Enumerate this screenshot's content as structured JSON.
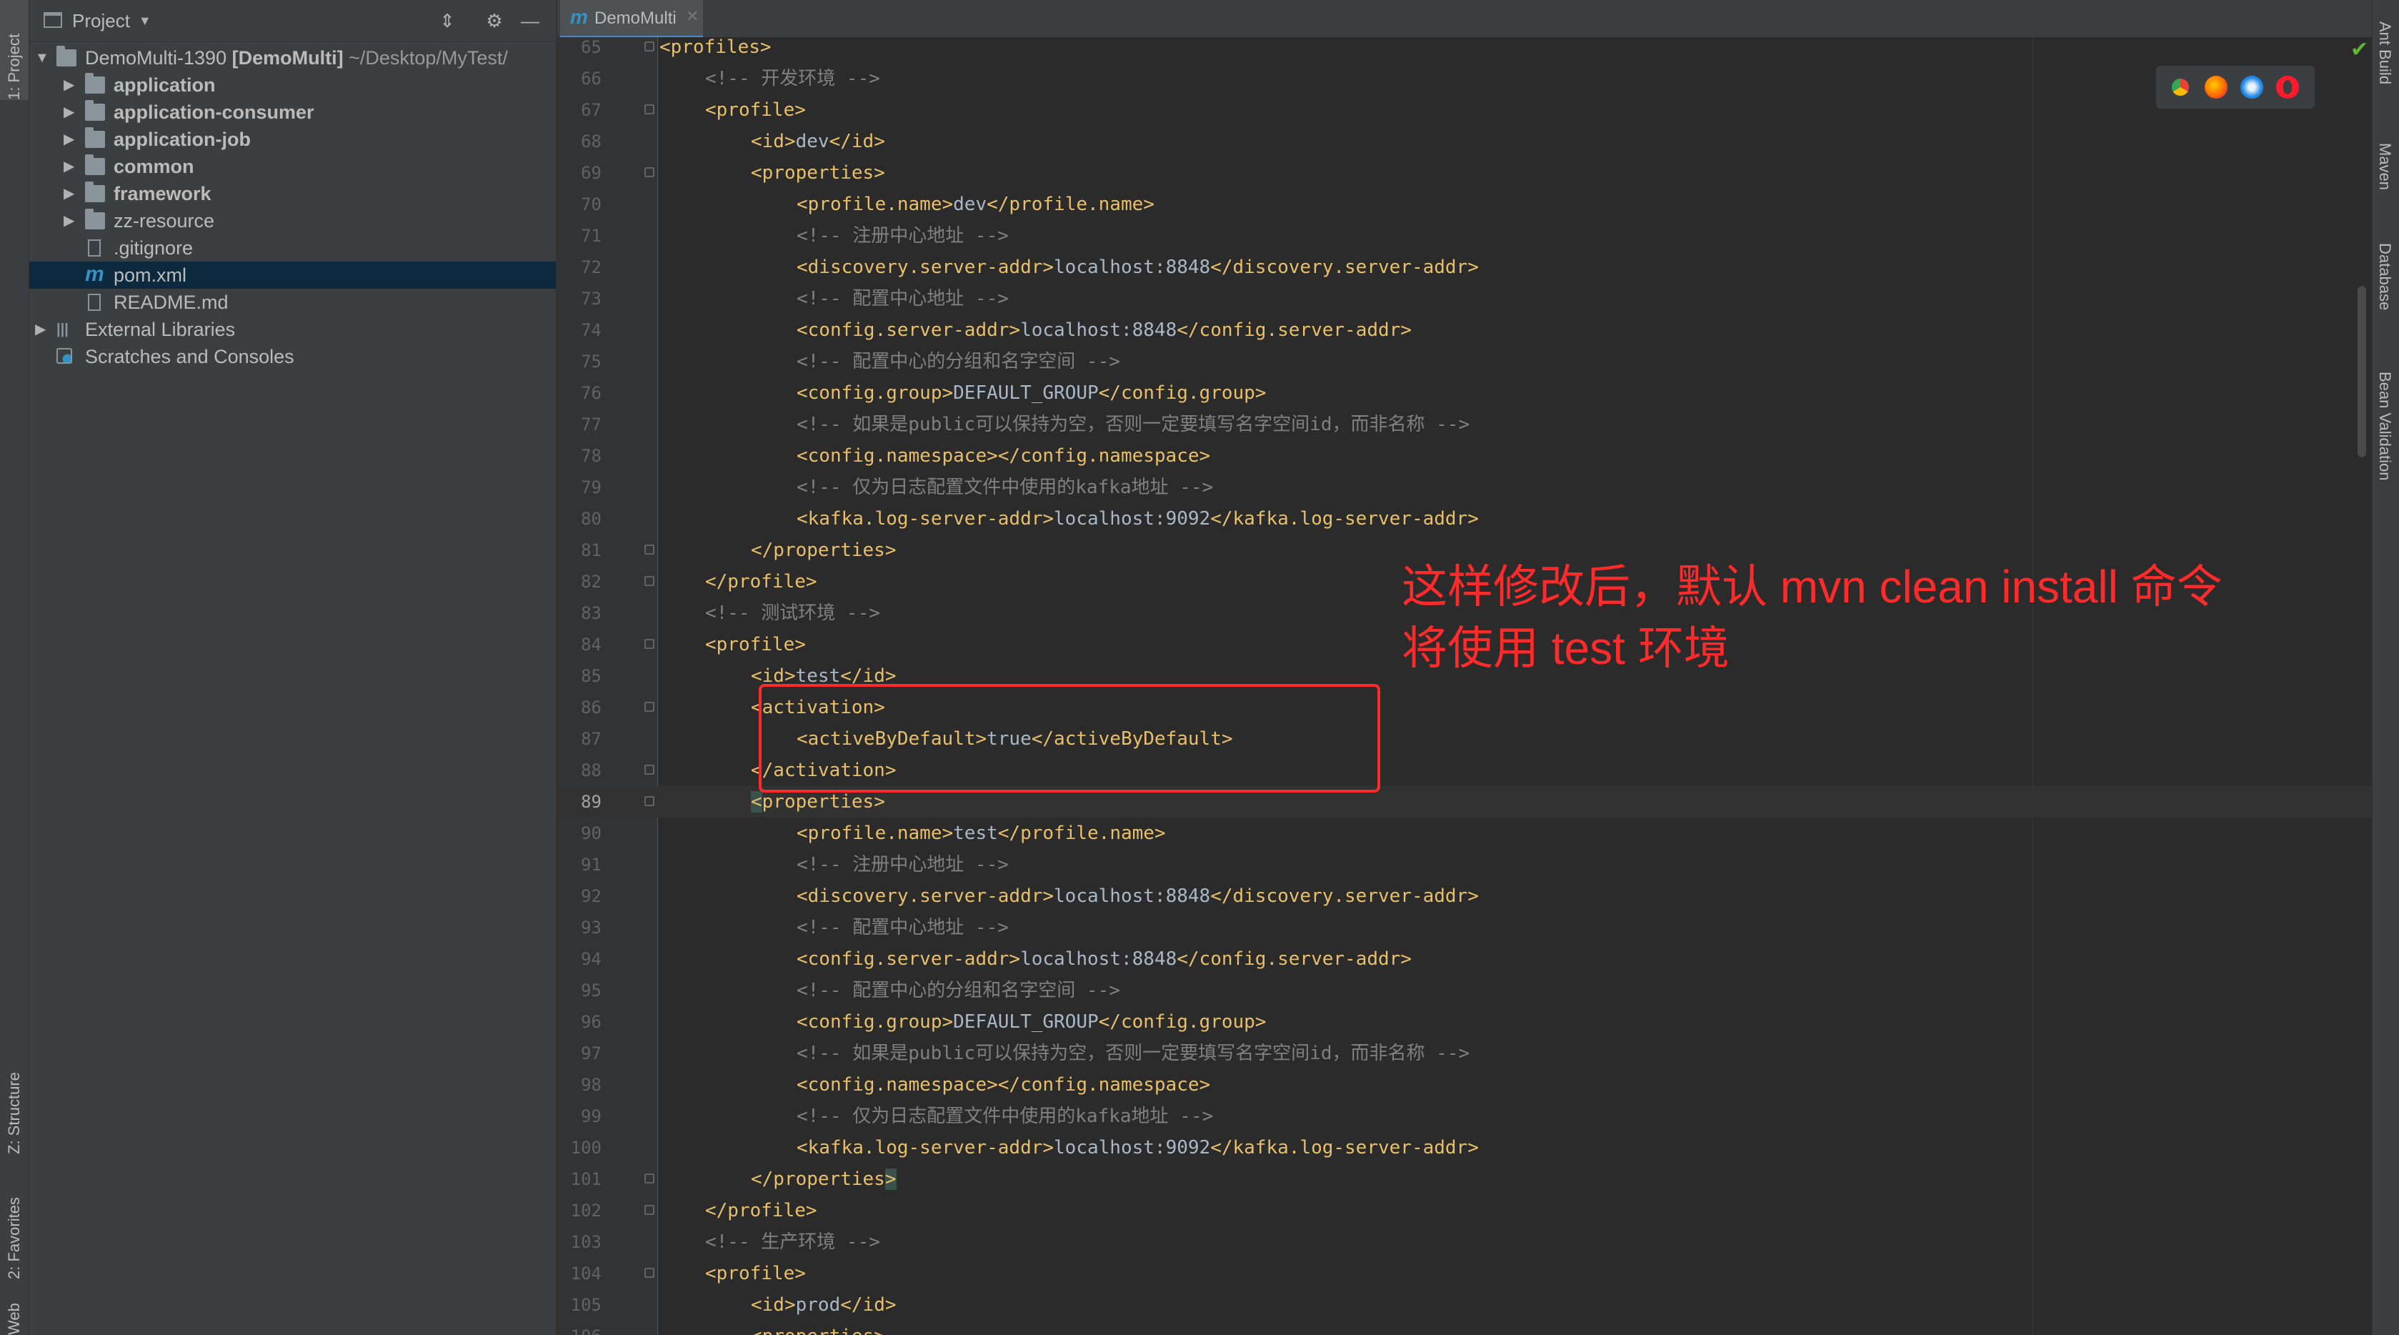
{
  "left_strip": {
    "project_tab": "1: Project",
    "structure_tab": "Z: Structure",
    "favorites_tab": "2: Favorites",
    "web_tab": "Web"
  },
  "project_panel": {
    "title": "Project",
    "tree": [
      {
        "label": "DemoMulti-1390",
        "extra": "[DemoMulti]",
        "path": "~/Desktop/MyTest/",
        "type": "module",
        "level": 0,
        "expanded": true
      },
      {
        "label": "application",
        "type": "folder",
        "level": 1,
        "bold": true
      },
      {
        "label": "application-consumer",
        "type": "folder",
        "level": 1,
        "bold": true
      },
      {
        "label": "application-job",
        "type": "folder",
        "level": 1,
        "bold": true
      },
      {
        "label": "common",
        "type": "folder",
        "level": 1,
        "bold": true
      },
      {
        "label": "framework",
        "type": "folder",
        "level": 1,
        "bold": true
      },
      {
        "label": "zz-resource",
        "type": "folder",
        "level": 1,
        "bold": false
      },
      {
        "label": ".gitignore",
        "type": "file",
        "level": 1
      },
      {
        "label": "pom.xml",
        "type": "maven",
        "level": 1,
        "selected": true
      },
      {
        "label": "README.md",
        "type": "md",
        "level": 1
      },
      {
        "label": "External Libraries",
        "type": "libs",
        "level": 0
      },
      {
        "label": "Scratches and Consoles",
        "type": "scratch",
        "level": 0
      }
    ]
  },
  "editor": {
    "tab_label": "DemoMulti",
    "current_line": 89,
    "lines": [
      {
        "n": "65",
        "i": 0,
        "p": [
          [
            "t",
            "<profiles>"
          ]
        ]
      },
      {
        "n": "66",
        "i": 1,
        "p": [
          [
            "c",
            "<!-- 开发环境 -->"
          ]
        ]
      },
      {
        "n": "67",
        "i": 1,
        "p": [
          [
            "t",
            "<profile>"
          ]
        ]
      },
      {
        "n": "68",
        "i": 2,
        "p": [
          [
            "t",
            "<id>"
          ],
          [
            "x",
            "dev"
          ],
          [
            "t",
            "</id>"
          ]
        ]
      },
      {
        "n": "69",
        "i": 2,
        "p": [
          [
            "t",
            "<properties>"
          ]
        ]
      },
      {
        "n": "70",
        "i": 3,
        "p": [
          [
            "t",
            "<profile.name>"
          ],
          [
            "x",
            "dev"
          ],
          [
            "t",
            "</profile.name>"
          ]
        ]
      },
      {
        "n": "71",
        "i": 3,
        "p": [
          [
            "c",
            "<!-- 注册中心地址 -->"
          ]
        ]
      },
      {
        "n": "72",
        "i": 3,
        "p": [
          [
            "t",
            "<discovery.server-addr>"
          ],
          [
            "x",
            "localhost:8848"
          ],
          [
            "t",
            "</discovery.server-addr>"
          ]
        ]
      },
      {
        "n": "73",
        "i": 3,
        "p": [
          [
            "c",
            "<!-- 配置中心地址 -->"
          ]
        ]
      },
      {
        "n": "74",
        "i": 3,
        "p": [
          [
            "t",
            "<config.server-addr>"
          ],
          [
            "x",
            "localhost:8848"
          ],
          [
            "t",
            "</config.server-addr>"
          ]
        ]
      },
      {
        "n": "75",
        "i": 3,
        "p": [
          [
            "c",
            "<!-- 配置中心的分组和名字空间 -->"
          ]
        ]
      },
      {
        "n": "76",
        "i": 3,
        "p": [
          [
            "t",
            "<config.group>"
          ],
          [
            "x",
            "DEFAULT_GROUP"
          ],
          [
            "t",
            "</config.group>"
          ]
        ]
      },
      {
        "n": "77",
        "i": 3,
        "p": [
          [
            "c",
            "<!-- 如果是public可以保持为空，否则一定要填写名字空间id，而非名称 -->"
          ]
        ]
      },
      {
        "n": "78",
        "i": 3,
        "p": [
          [
            "t",
            "<config.namespace></config.namespace>"
          ]
        ]
      },
      {
        "n": "79",
        "i": 3,
        "p": [
          [
            "c",
            "<!-- 仅为日志配置文件中使用的kafka地址 -->"
          ]
        ]
      },
      {
        "n": "80",
        "i": 3,
        "p": [
          [
            "t",
            "<kafka.log-server-addr>"
          ],
          [
            "x",
            "localhost:9092"
          ],
          [
            "t",
            "</kafka.log-server-addr>"
          ]
        ]
      },
      {
        "n": "81",
        "i": 2,
        "p": [
          [
            "t",
            "</properties>"
          ]
        ]
      },
      {
        "n": "82",
        "i": 1,
        "p": [
          [
            "t",
            "</profile>"
          ]
        ]
      },
      {
        "n": "83",
        "i": 1,
        "p": [
          [
            "c",
            "<!-- 测试环境 -->"
          ]
        ]
      },
      {
        "n": "84",
        "i": 1,
        "p": [
          [
            "t",
            "<profile>"
          ]
        ]
      },
      {
        "n": "85",
        "i": 2,
        "p": [
          [
            "t",
            "<id>"
          ],
          [
            "x",
            "test"
          ],
          [
            "t",
            "</id>"
          ]
        ]
      },
      {
        "n": "86",
        "i": 2,
        "p": [
          [
            "t",
            "<activation>"
          ]
        ]
      },
      {
        "n": "87",
        "i": 3,
        "p": [
          [
            "t",
            "<activeByDefault>"
          ],
          [
            "x",
            "true"
          ],
          [
            "t",
            "</activeByDefault>"
          ]
        ]
      },
      {
        "n": "88",
        "i": 2,
        "p": [
          [
            "t",
            "</activation>"
          ]
        ]
      },
      {
        "n": "89",
        "i": 2,
        "p": [
          [
            "h",
            "<"
          ],
          [
            "t",
            "properties>"
          ]
        ]
      },
      {
        "n": "90",
        "i": 3,
        "p": [
          [
            "t",
            "<profile.name>"
          ],
          [
            "x",
            "test"
          ],
          [
            "t",
            "</profile.name>"
          ]
        ]
      },
      {
        "n": "91",
        "i": 3,
        "p": [
          [
            "c",
            "<!-- 注册中心地址 -->"
          ]
        ]
      },
      {
        "n": "92",
        "i": 3,
        "p": [
          [
            "t",
            "<discovery.server-addr>"
          ],
          [
            "x",
            "localhost:8848"
          ],
          [
            "t",
            "</discovery.server-addr>"
          ]
        ]
      },
      {
        "n": "93",
        "i": 3,
        "p": [
          [
            "c",
            "<!-- 配置中心地址 -->"
          ]
        ]
      },
      {
        "n": "94",
        "i": 3,
        "p": [
          [
            "t",
            "<config.server-addr>"
          ],
          [
            "x",
            "localhost:8848"
          ],
          [
            "t",
            "</config.server-addr>"
          ]
        ]
      },
      {
        "n": "95",
        "i": 3,
        "p": [
          [
            "c",
            "<!-- 配置中心的分组和名字空间 -->"
          ]
        ]
      },
      {
        "n": "96",
        "i": 3,
        "p": [
          [
            "t",
            "<config.group>"
          ],
          [
            "x",
            "DEFAULT_GROUP"
          ],
          [
            "t",
            "</config.group>"
          ]
        ]
      },
      {
        "n": "97",
        "i": 3,
        "p": [
          [
            "c",
            "<!-- 如果是public可以保持为空，否则一定要填写名字空间id，而非名称 -->"
          ]
        ]
      },
      {
        "n": "98",
        "i": 3,
        "p": [
          [
            "t",
            "<config.namespace></config.namespace>"
          ]
        ]
      },
      {
        "n": "99",
        "i": 3,
        "p": [
          [
            "c",
            "<!-- 仅为日志配置文件中使用的kafka地址 -->"
          ]
        ]
      },
      {
        "n": "100",
        "i": 3,
        "p": [
          [
            "t",
            "<kafka.log-server-addr>"
          ],
          [
            "x",
            "localhost:9092"
          ],
          [
            "t",
            "</kafka.log-server-addr>"
          ]
        ]
      },
      {
        "n": "101",
        "i": 2,
        "p": [
          [
            "t",
            "</properties"
          ],
          [
            "h",
            ">"
          ]
        ]
      },
      {
        "n": "102",
        "i": 1,
        "p": [
          [
            "t",
            "</profile>"
          ]
        ]
      },
      {
        "n": "103",
        "i": 1,
        "p": [
          [
            "c",
            "<!-- 生产环境 -->"
          ]
        ]
      },
      {
        "n": "104",
        "i": 1,
        "p": [
          [
            "t",
            "<profile>"
          ]
        ]
      },
      {
        "n": "105",
        "i": 2,
        "p": [
          [
            "t",
            "<id>"
          ],
          [
            "x",
            "prod"
          ],
          [
            "t",
            "</id>"
          ]
        ]
      },
      {
        "n": "106",
        "i": 2,
        "p": [
          [
            "t",
            "<properties>"
          ]
        ]
      }
    ]
  },
  "annotation": {
    "line1": "这样修改后，默认 mvn clean install 命令",
    "line2": "将使用 test 环境",
    "color": "#ff2a2a"
  },
  "browser_icons": [
    "chrome-icon",
    "firefox-icon",
    "safari-icon",
    "opera-icon"
  ],
  "right_strip": {
    "ant": "Ant Build",
    "maven": "Maven",
    "database": "Database",
    "bean": "Bean Validation"
  }
}
